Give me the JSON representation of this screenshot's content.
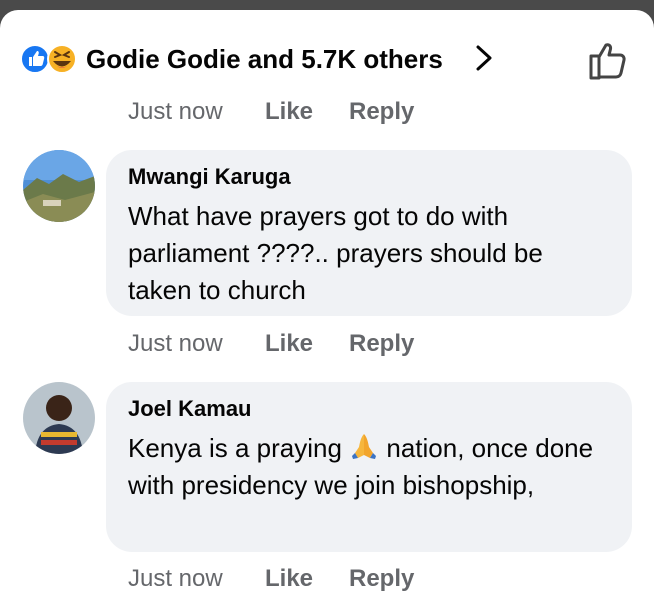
{
  "reactions": {
    "summary": "Godie Godie and 5.7K others",
    "icons": [
      "like-reaction-icon",
      "haha-reaction-icon"
    ]
  },
  "post_meta": {
    "time": "Just now",
    "like": "Like",
    "reply": "Reply"
  },
  "comments": [
    {
      "author": "Mwangi Karuga",
      "text": "What have prayers got to do with parliament ????.. prayers should be taken to church",
      "time": "Just now",
      "like": "Like",
      "reply": "Reply"
    },
    {
      "author": "Joel Kamau",
      "text_before": "Kenya is a praying",
      "text_after": "nation, once done with presidency we join bishopship,",
      "emoji": "folded-hands-emoji",
      "time": "Just now",
      "like": "Like",
      "reply": "Reply"
    }
  ],
  "colors": {
    "accent_blue": "#1877f2",
    "bubble": "#f0f2f5",
    "meta_text": "#65676b",
    "text": "#050505"
  }
}
